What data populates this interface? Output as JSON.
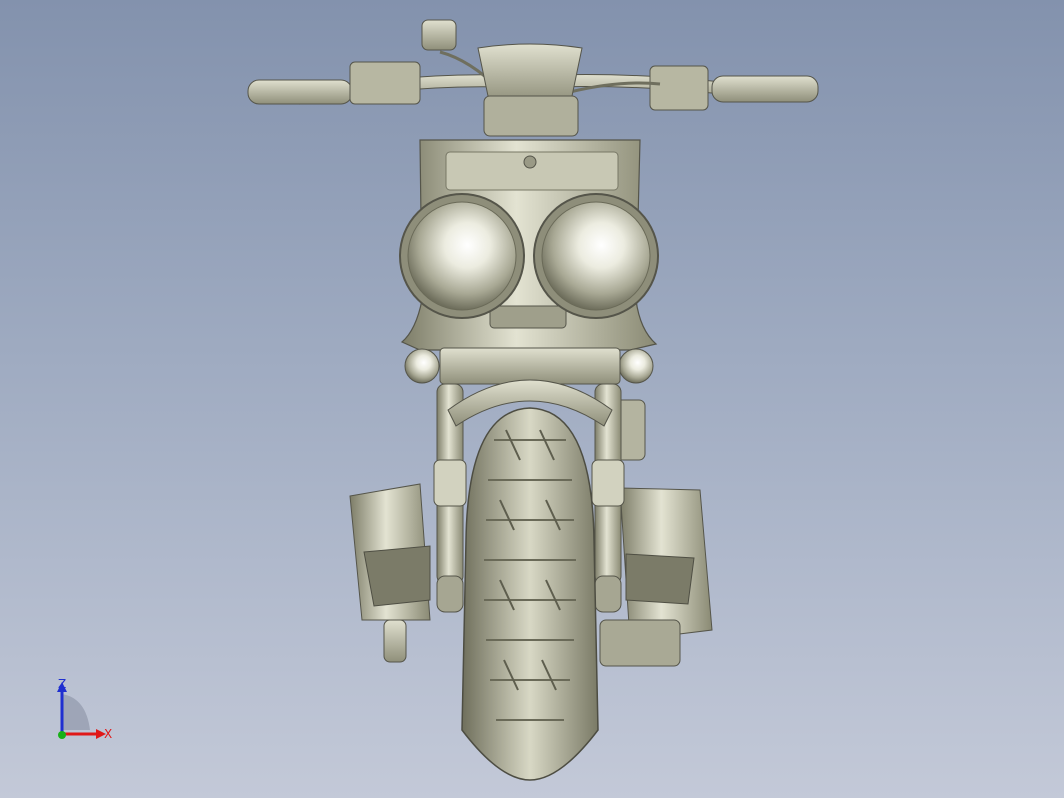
{
  "viewport": {
    "background_top": "#8392ad",
    "background_bottom": "#c3c9d8",
    "model_color": "#c9c9b4",
    "model_shade": "#8e8e78"
  },
  "triad": {
    "z_label": "Z",
    "x_label": "X",
    "z_color": "#1f2fd0",
    "x_color": "#e01818",
    "y_color": "#18b018"
  }
}
